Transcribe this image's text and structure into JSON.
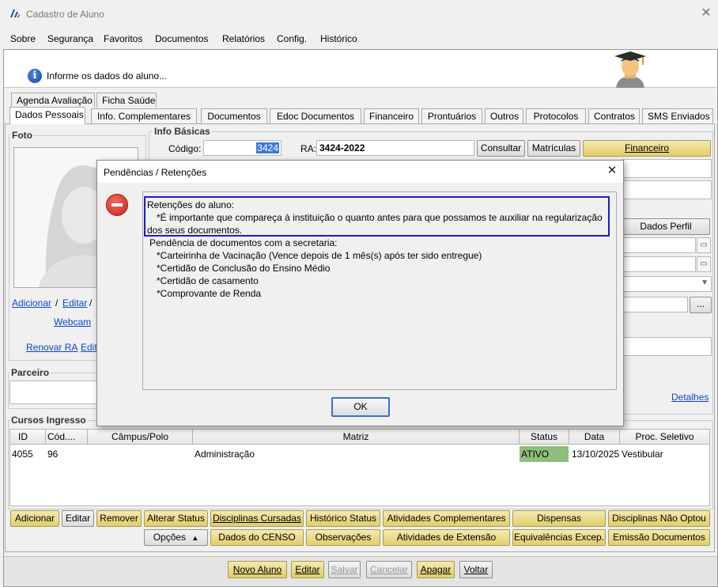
{
  "window": {
    "title": "Cadastro de Aluno"
  },
  "menu": [
    "Sobre",
    "Segurança",
    "Favoritos",
    "Documentos",
    "Relatórios",
    "Config.",
    "Histórico"
  ],
  "banner": {
    "info_text": "Informe os dados do aluno..."
  },
  "tabs_row1": [
    "Agenda Avaliação",
    "Ficha Saúde"
  ],
  "tabs_row2": [
    "Dados Pessoais",
    "Info. Complementares",
    "Documentos",
    "Edoc Documentos",
    "Financeiro",
    "Prontuários",
    "Outros",
    "Protocolos",
    "Contratos",
    "SMS Enviados"
  ],
  "foto": {
    "title": "Foto",
    "adicionar": "Adicionar",
    "sep1": "/",
    "editar": "Editar",
    "sep2": "/",
    "webcam": "Webcam",
    "renovar_ra": "Renovar RA",
    "edit_partial": "Edit"
  },
  "info_basicas": {
    "title": "Info Básicas",
    "codigo_label": "Código:",
    "codigo_value": "3424",
    "ra_label": "RA:",
    "ra_value": "3424-2022",
    "consultar": "Consultar",
    "matriculas": "Matrículas",
    "financeiro": "Financeiro",
    "dados_perfil": "Dados Perfil",
    "ellipsis": "...",
    "detalhes": "Detalhes"
  },
  "parceiro": {
    "title": "Parceiro"
  },
  "cursos": {
    "title": "Cursos Ingresso",
    "columns": [
      "ID",
      "Cód....",
      "Câmpus/Polo",
      "Matriz",
      "Status",
      "Data",
      "Proc. Seletivo"
    ],
    "rows": [
      {
        "id": "4055",
        "cod": "96",
        "campus": "",
        "matriz": "Administração",
        "status": "ATIVO",
        "data": "13/10/2025",
        "proc": "Vestibular"
      }
    ]
  },
  "action_row1": [
    "Adicionar",
    "Editar",
    "Remover",
    "Alterar Status",
    "Disciplinas Cursadas",
    "Histórico Status",
    "Atividades Complementares",
    "Dispensas",
    "Disciplinas Não Optou"
  ],
  "action_row2": [
    "Opções",
    "Dados do CENSO",
    "Observações",
    "Atividades de Extensão",
    "Equivalências Excep.",
    "Emissão Documentos"
  ],
  "bottom": [
    "Novo Aluno",
    "Editar",
    "Salvar",
    "Cancelar",
    "Apagar",
    "Voltar"
  ],
  "dialog": {
    "title": "Pendências / Retenções",
    "retencoes_title": "Retenções do aluno:",
    "retencoes_line1": "*É importante que compareça à instituição o quanto antes para que possamos te auxiliar na regularização",
    "retencoes_line2": "dos seus documentos.",
    "pendencias_title": "Pendência de documentos com a secretaria:",
    "pendencias": [
      "*Carteirinha de Vacinação (Vence depois de 1 mês(s) após ter sido entregue)",
      "*Certidão de Conclusão do Ensino Médio",
      "*Certidão de casamento",
      "*Comprovante de Renda"
    ],
    "ok": "OK"
  },
  "colors": {
    "accent_yellow": "#e2cd6a",
    "status_green": "#8fbf7c",
    "highlight_blue": "#1c1ccc",
    "error_red": "#d9302a",
    "link_blue": "#0b47c8"
  }
}
